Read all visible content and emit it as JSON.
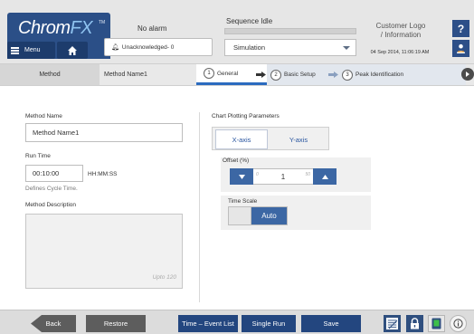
{
  "header": {
    "logo": {
      "chrom": "Chrom",
      "fx": "FX",
      "tm": "TM"
    },
    "menu_label": "Menu",
    "alarm_title": "No alarm",
    "unack_label": "Unacknowledged- 0",
    "sequence_title": "Sequence Idle",
    "sequence_progress": 0,
    "mode_select": "Simulation",
    "customer_logo_line1": "Customer Logo",
    "customer_logo_line2": "/ Information",
    "datetime": "04 Sep 2014, 11:06:19 AM",
    "help_label": "?"
  },
  "method_bar": {
    "label": "Method",
    "name": "Method Name1"
  },
  "wizard": {
    "steps": [
      {
        "num": "1",
        "label": "General"
      },
      {
        "num": "2",
        "label": "Basic Setup"
      },
      {
        "num": "3",
        "label": "Peak Identification"
      }
    ]
  },
  "form": {
    "method_name_label": "Method Name",
    "method_name_value": "Method Name1",
    "run_time_label": "Run Time",
    "run_time_value": "00:10:00",
    "run_time_unit": "HH:MM:SS",
    "run_time_hint": "Defines Cycle Time.",
    "description_label": "Method Description",
    "description_hint": "Upto 120"
  },
  "chart_params": {
    "title": "Chart Plotting Parameters",
    "tabs": [
      "X-axis",
      "Y-axis"
    ],
    "active_tab": "X-axis",
    "offset_label": "Offset (%)",
    "offset_min": "0",
    "offset_value": "1",
    "offset_max": "50",
    "time_scale_label": "Time Scale",
    "time_scale_value": "Auto"
  },
  "footer": {
    "back": "Back",
    "restore": "Restore",
    "time_event": "Time – Event List",
    "single_run": "Single Run",
    "save": "Save"
  },
  "colors": {
    "brand_dark_blue": "#1d3c6c",
    "accent_blue": "#3c67a4",
    "wizard_active": "#2b6bbf"
  }
}
